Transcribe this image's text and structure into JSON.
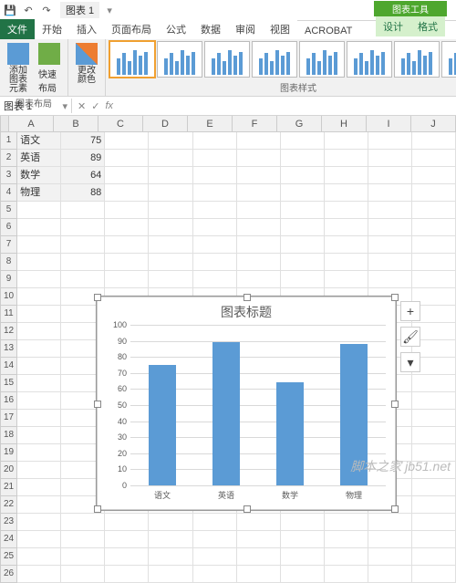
{
  "titlebar": {
    "doc_name": "图表 1"
  },
  "tabs": {
    "file": "文件",
    "home": "开始",
    "insert": "插入",
    "layout": "页面布局",
    "formulas": "公式",
    "data": "数据",
    "review": "审阅",
    "view": "视图",
    "acrobat": "ACROBAT",
    "context_title": "图表工具",
    "context_design": "设计",
    "context_format": "格式"
  },
  "ribbon": {
    "add_element": "添加图表\n元素",
    "quick_layout": "快速布局",
    "change_colors": "更改\n颜色",
    "group_layout": "图表布局",
    "group_styles": "图表样式"
  },
  "addr": {
    "name_box": "图表 1",
    "fx": "fx"
  },
  "columns": [
    "A",
    "B",
    "C",
    "D",
    "E",
    "F",
    "G",
    "H",
    "I",
    "J"
  ],
  "rows": 26,
  "cells": {
    "A1": "语文",
    "B1": "75",
    "A2": "英语",
    "B2": "89",
    "A3": "数学",
    "B3": "64",
    "A4": "物理",
    "B4": "88"
  },
  "chart_data": {
    "type": "bar",
    "title": "图表标题",
    "categories": [
      "语文",
      "英语",
      "数学",
      "物理"
    ],
    "values": [
      75,
      89,
      64,
      88
    ],
    "ylim": [
      0,
      100
    ],
    "yticks": [
      0,
      10,
      20,
      30,
      40,
      50,
      60,
      70,
      80,
      90,
      100
    ],
    "xlabel": "",
    "ylabel": ""
  },
  "side_buttons": {
    "plus": "+",
    "brush_icon": "brush",
    "filter_icon": "filter"
  },
  "watermark": "脚本之家 jb51.net"
}
